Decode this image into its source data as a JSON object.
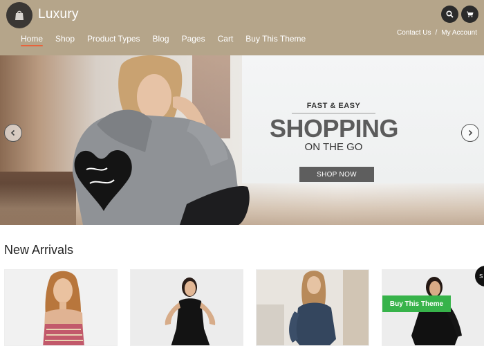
{
  "header": {
    "logo_text": "Luxury",
    "nav": [
      {
        "label": "Home",
        "active": true
      },
      {
        "label": "Shop"
      },
      {
        "label": "Product Types"
      },
      {
        "label": "Blog"
      },
      {
        "label": "Pages"
      },
      {
        "label": "Cart"
      },
      {
        "label": "Buy This Theme"
      }
    ],
    "top_links": {
      "contact": "Contact Us",
      "separator": "/",
      "account": "My Account"
    },
    "icons": {
      "search": "search-icon",
      "cart": "cart-icon",
      "logo": "shopping-bag-icon"
    }
  },
  "hero": {
    "kicker": "FAST & EASY",
    "headline": "SHOPPING",
    "subline": "ON THE GO",
    "cta": "SHOP NOW",
    "prev_icon": "chevron-left-icon",
    "next_icon": "chevron-right-icon"
  },
  "section": {
    "title": "New Arrivals"
  },
  "floating": {
    "buy_label": "Buy This Theme",
    "side_tab_label": "S"
  },
  "colors": {
    "header_bg": "#b5a58a",
    "accent": "#e8633b",
    "cta_bg": "#5e5e5e",
    "buy_green": "#37b34a"
  }
}
